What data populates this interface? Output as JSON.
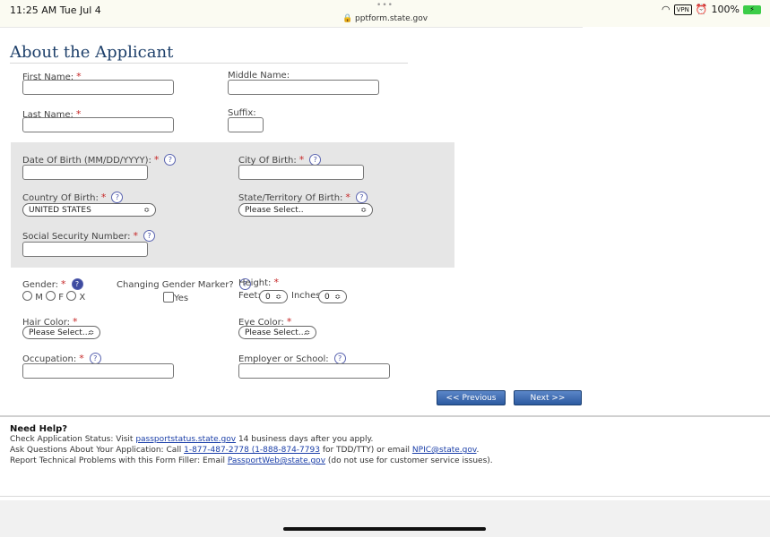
{
  "status_bar": {
    "time": "11:25 AM  Tue Jul 4",
    "dots": "•••",
    "url": "pptform.state.gov",
    "vpn": "VPN",
    "battery": "100%"
  },
  "page_title": "About the Applicant",
  "fields": {
    "first_name": {
      "label": "First Name:",
      "value": ""
    },
    "middle_name": {
      "label": "Middle Name:",
      "value": ""
    },
    "last_name": {
      "label": "Last Name:",
      "value": ""
    },
    "suffix": {
      "label": "Suffix:",
      "value": ""
    },
    "dob": {
      "label": "Date Of Birth (MM/DD/YYYY):",
      "value": ""
    },
    "city_of_birth": {
      "label": "City Of Birth:",
      "value": ""
    },
    "country_of_birth": {
      "label": "Country Of Birth:",
      "selected": "UNITED STATES"
    },
    "state_of_birth": {
      "label": "State/Territory Of Birth:",
      "selected": "Please Select.."
    },
    "ssn": {
      "label": "Social Security Number:",
      "value": ""
    },
    "gender": {
      "label": "Gender:",
      "options": [
        "M",
        "F",
        "X"
      ]
    },
    "gender_marker": {
      "label": "Changing Gender Marker?",
      "checkbox_label": "Yes"
    },
    "height": {
      "label": "Height:",
      "feet_label": "Feet:",
      "feet_value": "0",
      "inches_label": "Inches:",
      "inches_value": "0"
    },
    "hair_color": {
      "label": "Hair Color:",
      "selected": "Please Select..."
    },
    "eye_color": {
      "label": "Eye Color:",
      "selected": "Please Select..."
    },
    "occupation": {
      "label": "Occupation:",
      "value": ""
    },
    "employer": {
      "label": "Employer or School:",
      "value": ""
    }
  },
  "icons": {
    "required": "*",
    "help": "?",
    "select_arrow": "≎"
  },
  "buttons": {
    "previous": "<< Previous",
    "next": "Next >>"
  },
  "help": {
    "title": "Need Help?",
    "line1_pre": "Check Application Status: Visit ",
    "line1_link": "passportstatus.state.gov",
    "line1_post": " 14 business days after you apply.",
    "line2_pre": "Ask Questions About Your Application: Call ",
    "line2_link1": "1-877-487-2778 (1-888-874-7793",
    "line2_mid": " for TDD/TTY) or email ",
    "line2_link2": "NPIC@state.gov",
    "line2_post": ".",
    "line3_pre": "Report Technical Problems with this Form Filler: Email ",
    "line3_link": "PassportWeb@state.gov",
    "line3_post": " (do not use for customer service issues)."
  },
  "colors": {
    "title": "#1d3f6a",
    "required": "#c62828",
    "button": "#2c5aa0",
    "link": "#1a3ea8"
  }
}
